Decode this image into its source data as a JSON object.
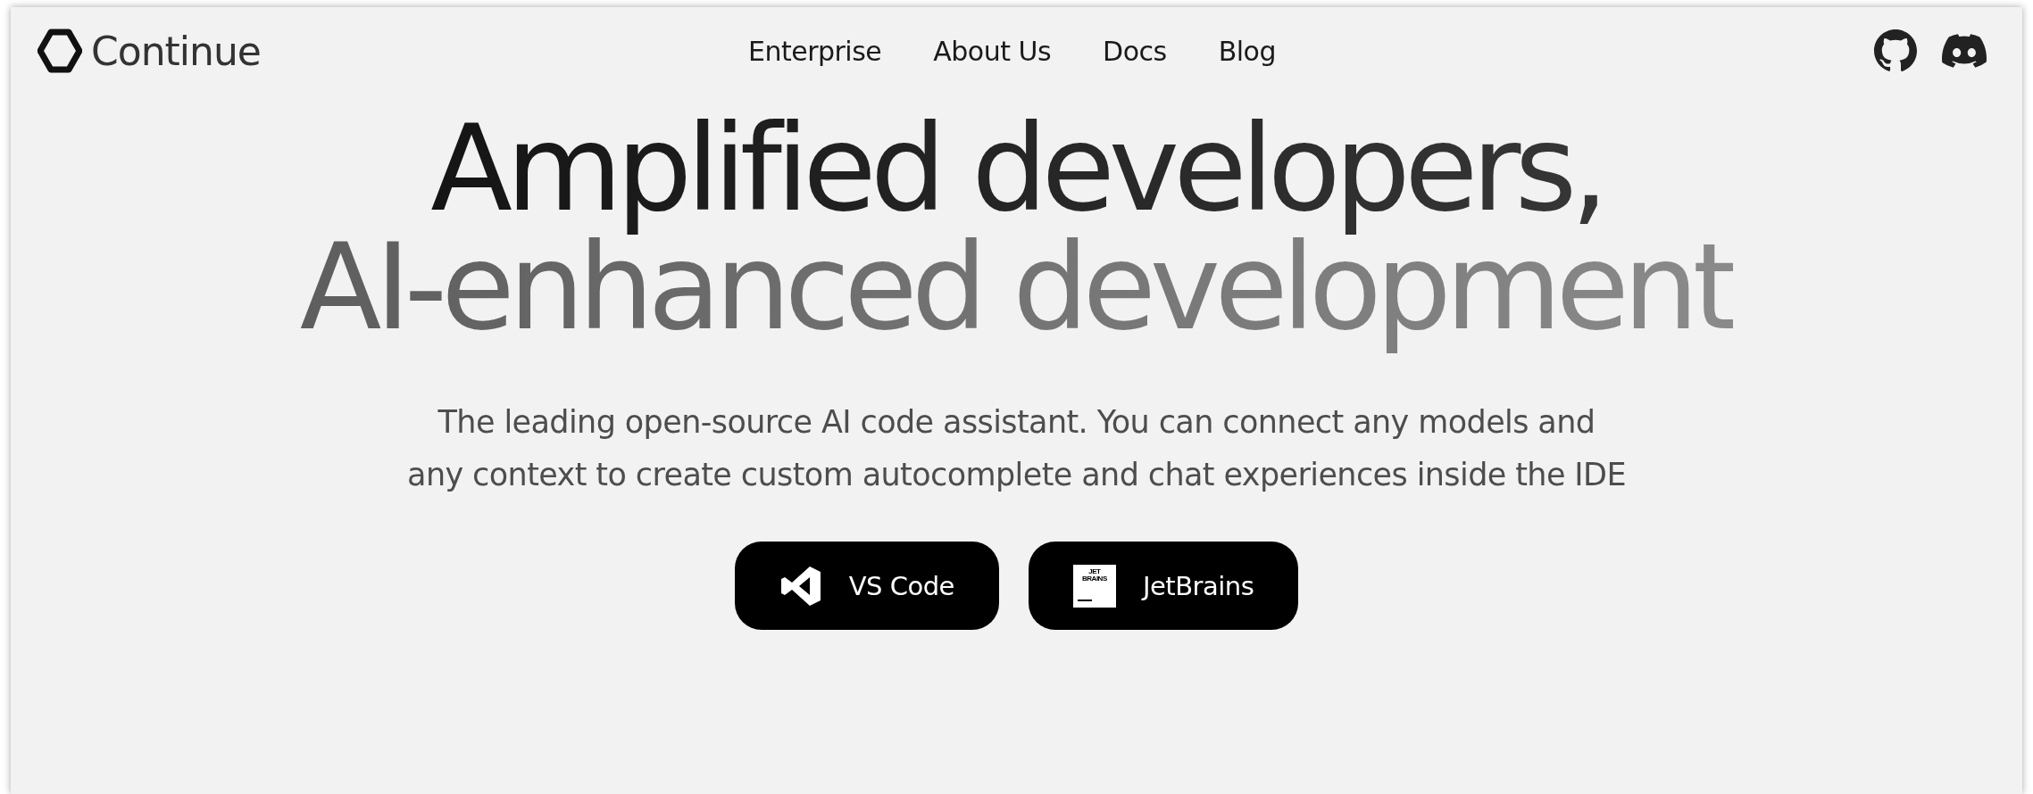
{
  "header": {
    "brand": "Continue",
    "nav": [
      "Enterprise",
      "About Us",
      "Docs",
      "Blog"
    ]
  },
  "hero": {
    "headline": [
      "Amplified developers,",
      "AI-enhanced development"
    ],
    "description": [
      "The leading open-source AI code assistant. You can connect any models and",
      "any context to create custom autocomplete and chat experiences inside the IDE"
    ],
    "buttons": [
      {
        "kind": "vscode",
        "label": "VS Code"
      },
      {
        "kind": "jetbrains",
        "label": "JetBrains",
        "logo_text": [
          "JET",
          "BRAINS"
        ]
      }
    ]
  }
}
